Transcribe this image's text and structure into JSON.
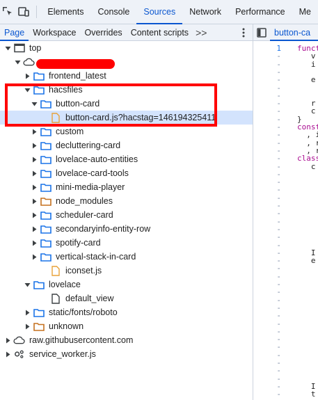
{
  "toolbar": {
    "icons": [
      "inspect-element-icon",
      "device-toggle-icon"
    ],
    "tabs": [
      {
        "label": "Elements",
        "active": false
      },
      {
        "label": "Console",
        "active": false
      },
      {
        "label": "Sources",
        "active": true
      },
      {
        "label": "Network",
        "active": false
      },
      {
        "label": "Performance",
        "active": false
      },
      {
        "label": "Me",
        "active": false
      }
    ]
  },
  "sources_subtabs": {
    "tabs": [
      {
        "label": "Page",
        "active": true
      },
      {
        "label": "Workspace",
        "active": false
      },
      {
        "label": "Overrides",
        "active": false
      },
      {
        "label": "Content scripts",
        "active": false
      }
    ],
    "more": ">>",
    "menu_icon": "kebab-menu-icon"
  },
  "editor_tab": {
    "label": "button-ca"
  },
  "tree": [
    {
      "label": "top",
      "icon": "frame",
      "expanded": true
    },
    {
      "label": "",
      "icon": "cloud",
      "expanded": true,
      "redacted": true
    },
    {
      "label": "frontend_latest",
      "icon": "folder-blue",
      "expanded": false
    },
    {
      "label": "hacsfiles",
      "icon": "folder-blue",
      "expanded": true
    },
    {
      "label": "button-card",
      "icon": "folder-blue",
      "expanded": true
    },
    {
      "label": "button-card.js?hacstag=146194325411",
      "icon": "file-js",
      "selected": true
    },
    {
      "label": "custom",
      "icon": "folder-blue",
      "expanded": false
    },
    {
      "label": "decluttering-card",
      "icon": "folder-blue",
      "expanded": false
    },
    {
      "label": "lovelace-auto-entities",
      "icon": "folder-blue",
      "expanded": false
    },
    {
      "label": "lovelace-card-tools",
      "icon": "folder-blue",
      "expanded": false
    },
    {
      "label": "mini-media-player",
      "icon": "folder-blue",
      "expanded": false
    },
    {
      "label": "node_modules",
      "icon": "folder-orange",
      "expanded": false
    },
    {
      "label": "scheduler-card",
      "icon": "folder-blue",
      "expanded": false
    },
    {
      "label": "secondaryinfo-entity-row",
      "icon": "folder-blue",
      "expanded": false
    },
    {
      "label": "spotify-card",
      "icon": "folder-blue",
      "expanded": false
    },
    {
      "label": "vertical-stack-in-card",
      "icon": "folder-blue",
      "expanded": false
    },
    {
      "label": "iconset.js",
      "icon": "file-js"
    },
    {
      "label": "lovelace",
      "icon": "folder-blue",
      "expanded": true
    },
    {
      "label": "default_view",
      "icon": "file-doc"
    },
    {
      "label": "static/fonts/roboto",
      "icon": "folder-blue",
      "expanded": false
    },
    {
      "label": "unknown",
      "icon": "folder-orange",
      "expanded": false
    },
    {
      "label": "raw.githubusercontent.com",
      "icon": "cloud",
      "expanded": false
    },
    {
      "label": "service_worker.js",
      "icon": "gears",
      "expanded": false
    }
  ],
  "editor": {
    "line_numbers": [
      "1",
      "-",
      "-",
      "-",
      "-",
      "-",
      "-",
      "-",
      "-",
      "-",
      "-",
      "-",
      "-",
      "-",
      "-",
      "-",
      "-",
      "-",
      "-",
      "-",
      "-",
      "-",
      "-",
      "-",
      "-",
      "-",
      "-",
      "-",
      "-",
      "-",
      "-",
      "-",
      "-",
      "-",
      "-",
      "-",
      "-",
      "-",
      "-",
      "-",
      "-",
      "-",
      "-",
      "-",
      "-",
      "-",
      "-"
    ],
    "code_lines": [
      "funct",
      "   v",
      "   i",
      "",
      "   e",
      "",
      "",
      "   r",
      "   c",
      "}",
      "const",
      "  , i",
      "  , r",
      "  , r",
      "class",
      "   c",
      "",
      "",
      "",
      "",
      "",
      "",
      "",
      "",
      "",
      "",
      "   I",
      "   e",
      "",
      "",
      "",
      "",
      "",
      "",
      "",
      "",
      "",
      "",
      "",
      "",
      "",
      "",
      "",
      "   I",
      "   t",
      "",
      ""
    ]
  },
  "colors": {
    "accent": "#0b57d0",
    "highlight": "#ff0000",
    "folder_blue": "#1a73e8",
    "folder_orange": "#c5711f",
    "file_orange": "#e8a23a"
  }
}
